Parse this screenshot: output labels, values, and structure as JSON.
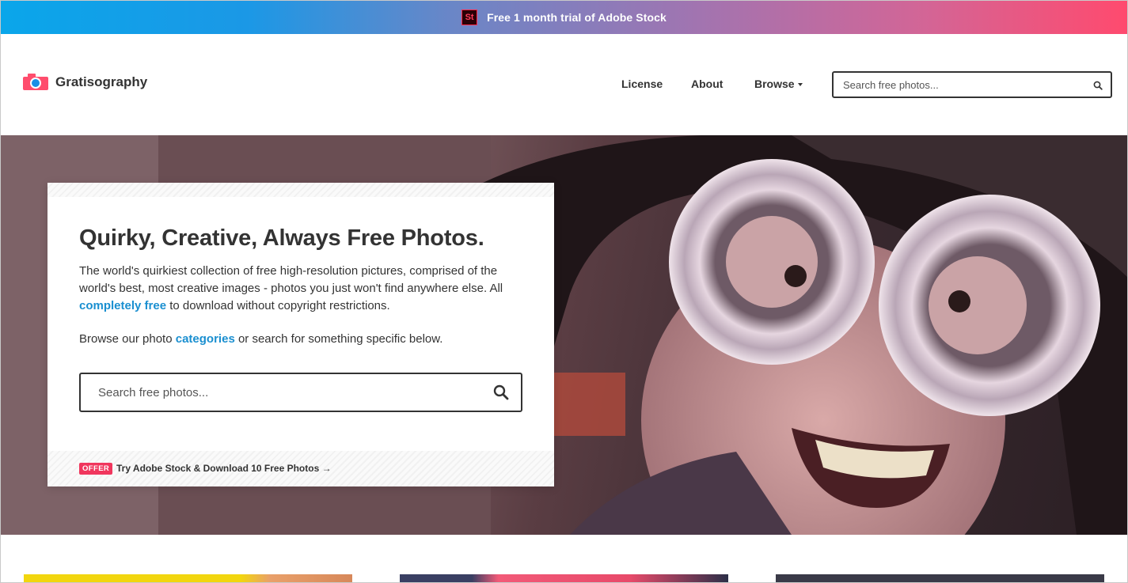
{
  "promo": {
    "badge": "St",
    "text": "Free 1 month trial of Adobe Stock"
  },
  "brand": {
    "name": "Gratisography"
  },
  "nav": {
    "license": "License",
    "about": "About",
    "browse": "Browse"
  },
  "header_search": {
    "placeholder": "Search free photos..."
  },
  "hero": {
    "title": "Quirky, Creative, Always Free Photos.",
    "intro": "The world's quirkiest collection of free high-resolution pictures, comprised of the world's best, most creative images - photos you just won't find anywhere else. All ",
    "intro_link": "completely free",
    "intro_tail": " to download without copyright restrictions.",
    "browse_pre": "Browse our photo ",
    "browse_link": "categories",
    "browse_tail": " or search for something specific below.",
    "search_placeholder": "Search free photos...",
    "offer_badge": "OFFER",
    "offer_text": "Try Adobe Stock & Download 10 Free Photos",
    "offer_arrow": "→"
  },
  "colors": {
    "accent_blue": "#1a8fd0",
    "brand_pink": "#ff4d6d",
    "offer_red": "#f0365d",
    "text": "#333333"
  },
  "icons": [
    "adobe-stock-icon",
    "camera-logo-icon",
    "caret-down-icon",
    "search-icon"
  ]
}
